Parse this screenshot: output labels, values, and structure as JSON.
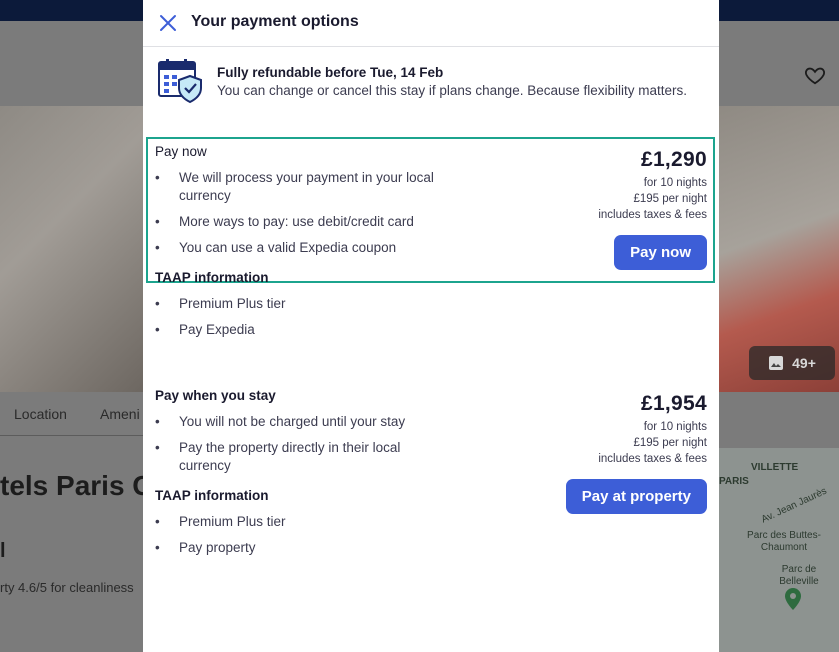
{
  "modal": {
    "title": "Your payment options",
    "refund": {
      "title": "Fully refundable before Tue, 14 Feb",
      "description": "You can change or cancel this stay if plans change. Because flexibility matters."
    },
    "pay_now": {
      "heading": "Pay now",
      "bullets": [
        "We will process your payment in your local currency",
        "More ways to pay: use debit/credit card",
        "You can use a valid Expedia coupon"
      ],
      "taap_heading": "TAAP information",
      "taap_bullets": [
        "Premium Plus tier",
        "Pay Expedia"
      ],
      "price": "£1,290",
      "nights": "for 10 nights",
      "per_night": "£195 per night",
      "taxes": "includes taxes & fees",
      "button_label": "Pay now"
    },
    "pay_later": {
      "heading": "Pay when you stay",
      "bullets": [
        "You will not be charged until your stay",
        "Pay the property directly in their local currency"
      ],
      "taap_heading": "TAAP information",
      "taap_bullets": [
        "Premium Plus tier",
        "Pay property"
      ],
      "price": "£1,954",
      "nights": "for 10 nights",
      "per_night": "£195 per night",
      "taxes": "includes taxes & fees",
      "button_label": "Pay at property"
    }
  },
  "background": {
    "tabs": [
      "Location",
      "Ameni"
    ],
    "hotel_title": "tels Paris G",
    "hotel_subtitle": "l",
    "hotel_rating": "rty 4.6/5 for cleanliness",
    "photo_count": "49+",
    "map_labels": [
      "VILLETTE",
      "PARIS",
      "Av. Jean Jaurès",
      "Parc des Buttes-Chaumont",
      "Parc de Belleville"
    ]
  },
  "colors": {
    "accent": "#3d5ed7",
    "highlight_border": "#1ca48e",
    "top_bar": "#0c1a3a"
  }
}
